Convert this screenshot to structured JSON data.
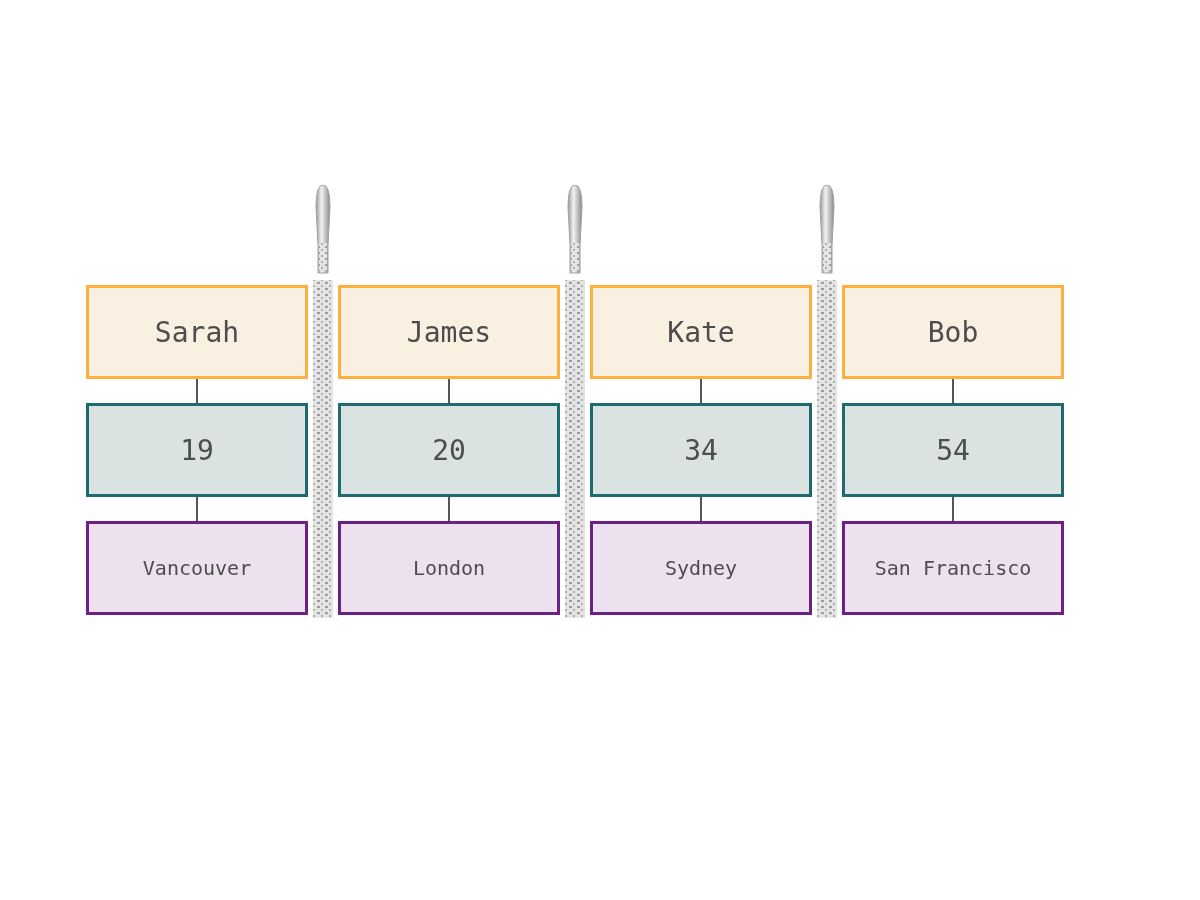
{
  "records": [
    {
      "name": "Sarah",
      "age": "19",
      "city": "Vancouver"
    },
    {
      "name": "James",
      "age": "20",
      "city": "London"
    },
    {
      "name": "Kate",
      "age": "34",
      "city": "Sydney"
    },
    {
      "name": "Bob",
      "age": "54",
      "city": "San Francisco"
    }
  ]
}
